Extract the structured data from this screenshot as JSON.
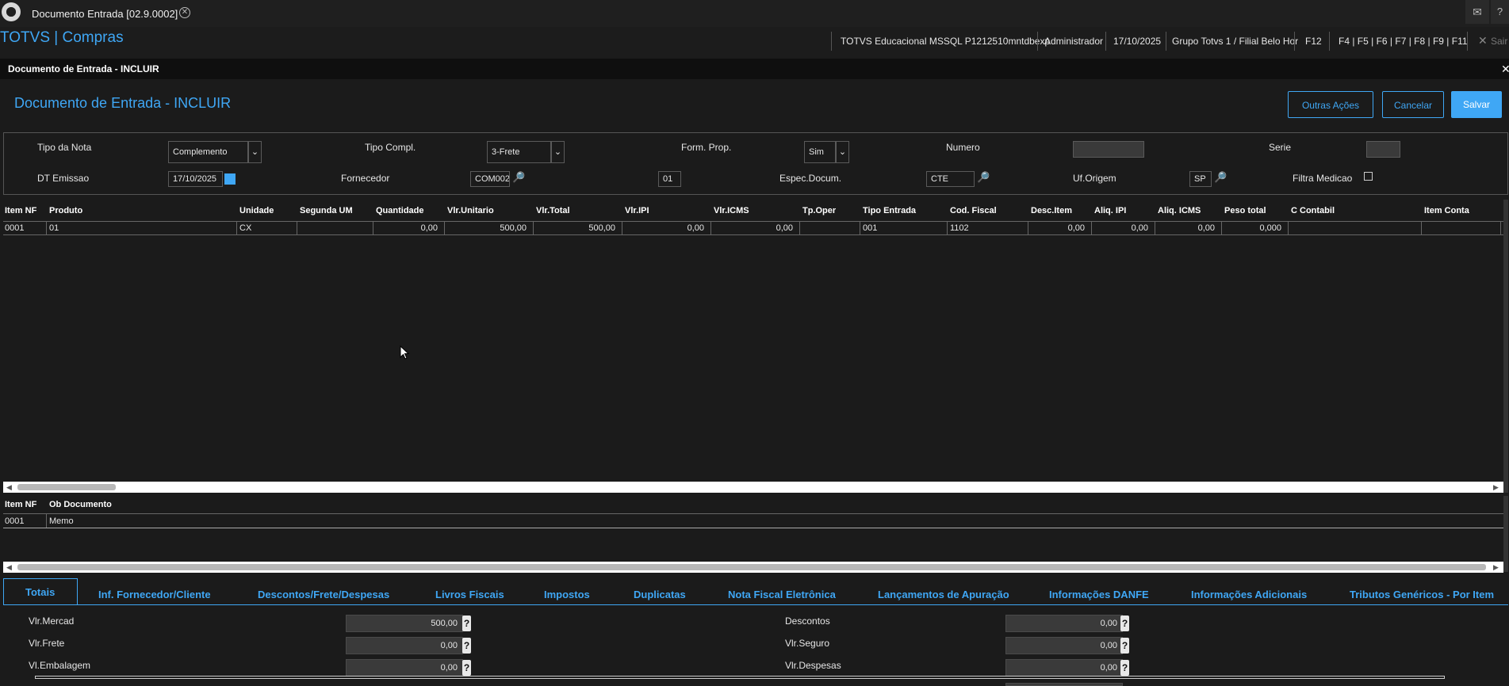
{
  "tab": {
    "title": "Documento Entrada [02.9.0002]"
  },
  "app": {
    "title": "TOTVS | Compras",
    "environment": "TOTVS Educacional MSSQL P1212510mntdbexp",
    "user": "Administrador",
    "date": "17/10/2025",
    "branch": "Grupo Totvs 1 / Filial Belo Hor",
    "shortcut_f12": "F12",
    "shortcuts": "F4 | F5 | F6 | F7 | F8 | F9 | F11",
    "logout": "Sair"
  },
  "window": {
    "title": "Documento de Entrada - INCLUIR"
  },
  "header": {
    "title": "Documento de Entrada - INCLUIR",
    "btn_other": "Outras Ações",
    "btn_cancel": "Cancelar",
    "btn_save": "Salvar"
  },
  "form": {
    "tipo_nota_label": "Tipo da Nota",
    "tipo_nota_value": "Complemento",
    "tipo_compl_label": "Tipo Compl.",
    "tipo_compl_value": "3-Frete",
    "form_prop_label": "Form. Prop.",
    "form_prop_value": "Sim",
    "numero_label": "Numero",
    "numero_value": "",
    "serie_label": "Serie",
    "serie_value": "",
    "dt_emissao_label": "DT Emissao",
    "dt_emissao_value": "17/10/2025",
    "fornecedor_label": "Fornecedor",
    "fornecedor_value": "COM002",
    "loja_value": "01",
    "espec_label": "Espec.Docum.",
    "espec_value": "CTE",
    "uf_label": "Uf.Origem",
    "uf_value": "SP",
    "filtra_label": "Filtra Medicao"
  },
  "items_grid": {
    "columns": [
      "Item NF",
      "Produto",
      "Unidade",
      "Segunda UM",
      "Quantidade",
      "Vlr.Unitario",
      "Vlr.Total",
      "Vlr.IPI",
      "Vlr.ICMS",
      "Tp.Oper",
      "Tipo Entrada",
      "Cod. Fiscal",
      "Desc.Item",
      "Aliq. IPI",
      "Aliq. ICMS",
      "Peso total",
      "C Contabil",
      "Item Conta"
    ],
    "row": [
      "0001",
      "01",
      "CX",
      "",
      "0,00",
      "500,00",
      "500,00",
      "0,00",
      "0,00",
      "",
      "001",
      "1102",
      "0,00",
      "0,00",
      "0,00",
      "0,000",
      "",
      ""
    ]
  },
  "obs_grid": {
    "columns": [
      "Item NF",
      "Ob Documento"
    ],
    "row": [
      "0001",
      "Memo"
    ]
  },
  "tabs": [
    "Totais",
    "Inf. Fornecedor/Cliente",
    "Descontos/Frete/Despesas",
    "Livros Fiscais",
    "Impostos",
    "Duplicatas",
    "Nota Fiscal Eletrônica",
    "Lançamentos de Apuração",
    "Informações DANFE",
    "Informações Adicionais",
    "Tributos Genéricos - Por Item"
  ],
  "totals": {
    "vlr_mercad_label": "Vlr.Mercad",
    "vlr_mercad": "500,00",
    "vlr_frete_label": "Vlr.Frete",
    "vlr_frete": "0,00",
    "vl_embalagem_label": "Vl.Embalagem",
    "vl_embalagem": "0,00",
    "descontos_label": "Descontos",
    "descontos": "0,00",
    "vlr_seguro_label": "Vlr.Seguro",
    "vlr_seguro": "0,00",
    "vlr_despesas_label": "Vlr.Despesas",
    "vlr_despesas": "0,00",
    "help": "?"
  },
  "colors": {
    "accent": "#3fa7f5",
    "background": "#1b1b1b"
  }
}
